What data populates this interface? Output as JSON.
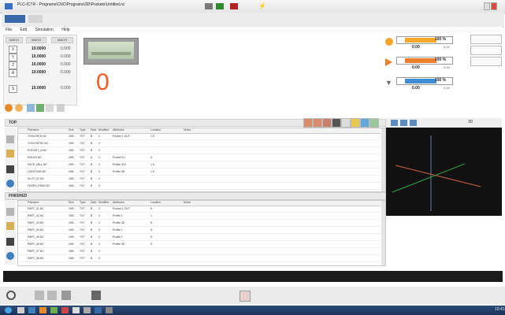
{
  "window": {
    "title": "PLC-ICTR - Programs\\CNC\\Programs\\3D\\Pockets\\Untitled.nc"
  },
  "menu": [
    "File",
    "Edit",
    "Simulation",
    "Help"
  ],
  "dro": {
    "headers": [
      "MACH",
      "MACH",
      "MACH"
    ],
    "axes": [
      {
        "label": "X",
        "value": "10.0000",
        "unit": "0.000"
      },
      {
        "label": "Y",
        "value": "10.0000",
        "unit": "0.000"
      },
      {
        "label": "Z",
        "value": "10.0000",
        "unit": "0.000"
      },
      {
        "label": "A",
        "value": "10.0000",
        "unit": "0.000"
      },
      {
        "label": "",
        "value": "",
        "unit": ""
      },
      {
        "label": "S",
        "value": "10.0000",
        "unit": "0.000"
      }
    ]
  },
  "main_counter": "0",
  "overrides": [
    {
      "icon": "feed-override-icon",
      "color": "#f4a52a",
      "percent": "100 %",
      "value": "0.00",
      "small": "0.00"
    },
    {
      "icon": "rapid-override-icon",
      "color": "#ef7e2b",
      "percent": "100 %",
      "value": "0.00",
      "small": "0.00"
    },
    {
      "icon": "spindle-override-icon",
      "color": "#3f8fd8",
      "percent": "100 %",
      "value": "0.00",
      "small": "0.00"
    }
  ],
  "top_panel": {
    "title": "TOP",
    "columns": [
      "Filename",
      "Size",
      "Type",
      "Date",
      "Modified",
      "Attributes",
      "Location",
      "Notes"
    ],
    "rows": [
      [
        "TOOLPATH.NC",
        "1KB",
        "TXT",
        "B",
        "C",
        "Pocket 1 OUT",
        "1.5",
        ""
      ],
      [
        "TOOLPATH2.NC",
        "1KB",
        "TXT",
        "B",
        "C",
        "",
        "",
        ""
      ],
      [
        "POCKET_A.NC",
        "1KB",
        "TXT",
        "B",
        "C",
        "",
        "",
        ""
      ],
      [
        "HOLES.NC",
        "2KB",
        "TXT",
        "A",
        "C",
        "Pocket 10",
        "5",
        ""
      ],
      [
        "FACE_MILL.NC",
        "2KB",
        "TXT",
        "B",
        "C",
        "Profile 320",
        "1.5",
        ""
      ],
      [
        "CONTOUR.NC",
        "2KB",
        "TXT",
        "B",
        "C",
        "Profile 3D",
        "1.5",
        ""
      ],
      [
        "SLOT_01.NC",
        "1KB",
        "TXT",
        "B",
        "C",
        "",
        "",
        ""
      ],
      [
        "FINISH_PASS.NC",
        "1KB",
        "TXT",
        "B",
        "C",
        "",
        "",
        ""
      ]
    ]
  },
  "bottom_panel": {
    "title": "FINISHED",
    "columns": [
      "Filename",
      "Size",
      "Type",
      "Date",
      "Modified",
      "Attributes",
      "Location",
      "Notes"
    ],
    "rows": [
      [
        "PART_01.NC",
        "1KB",
        "TXT",
        "B",
        "C",
        "Pocket 1 OUT",
        "5",
        ""
      ],
      [
        "PART_02.NC",
        "1KB",
        "TXT",
        "B",
        "C",
        "Profile 1",
        "1",
        ""
      ],
      [
        "PART_03.NC",
        "2KB",
        "TXT",
        "B",
        "C",
        "Profile 3D",
        "5",
        ""
      ],
      [
        "PART_04.NC",
        "1KB",
        "TXT",
        "B",
        "C",
        "Profile 1",
        "5",
        ""
      ],
      [
        "PART_05.NC",
        "1KB",
        "TXT",
        "B",
        "C",
        "Profile 1",
        "5",
        ""
      ],
      [
        "PART_06.NC",
        "2KB",
        "TXT",
        "B",
        "C",
        "Profile 3D",
        "5",
        ""
      ],
      [
        "PART_07.NC",
        "1KB",
        "TXT",
        "B",
        "C",
        "",
        "",
        ""
      ],
      [
        "PART_08.NC",
        "1KB",
        "TXT",
        "B",
        "C",
        "",
        "",
        ""
      ]
    ]
  },
  "view": {
    "label": "3D"
  },
  "clock": "10:41"
}
